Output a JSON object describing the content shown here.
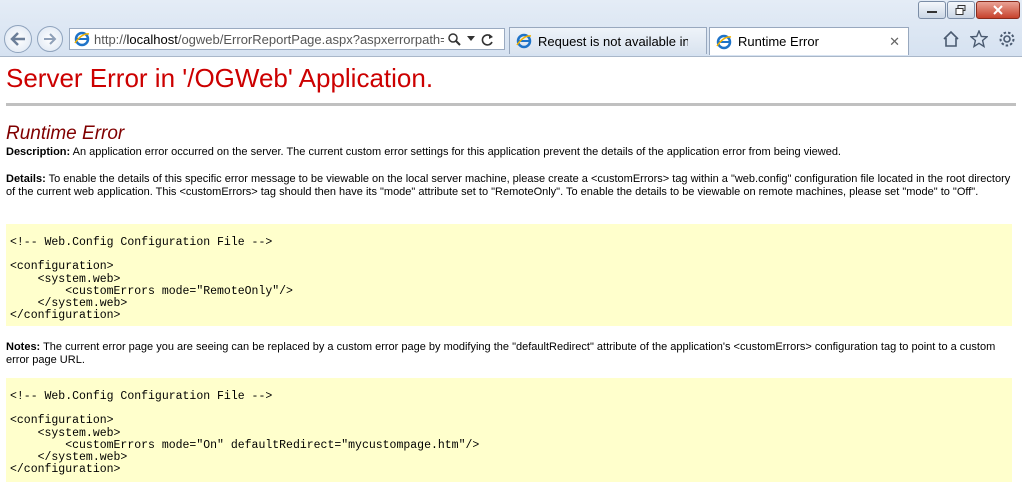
{
  "browser": {
    "url_prefix": "http://",
    "url_host": "localhost",
    "url_path": "/ogweb/ErrorReportPage.aspx?aspxerrorpath=",
    "tabs": [
      {
        "title": "Request is not available in th..."
      },
      {
        "title": "Runtime Error"
      }
    ]
  },
  "page": {
    "heading": "Server Error in '/OGWeb' Application.",
    "subheading": "Runtime Error",
    "description_label": "Description:",
    "description_text": " An application error occurred on the server. The current custom error settings for this application prevent the details of the application error from being viewed.",
    "details_label": "Details:",
    "details_text": " To enable the details of this specific error message to be viewable on the local server machine, please create a <customErrors> tag within a \"web.config\" configuration file located in the root directory of the current web application. This <customErrors> tag should then have its \"mode\" attribute set to \"RemoteOnly\". To enable the details to be viewable on remote machines, please set \"mode\" to \"Off\".",
    "code1": "<!-- Web.Config Configuration File -->\n\n<configuration>\n    <system.web>\n        <customErrors mode=\"RemoteOnly\"/>\n    </system.web>\n</configuration>",
    "notes_label": "Notes:",
    "notes_text": " The current error page you are seeing can be replaced by a custom error page by modifying the \"defaultRedirect\" attribute of the application's <customErrors> configuration tag to point to a custom error page URL.",
    "code2": "<!-- Web.Config Configuration File -->\n\n<configuration>\n    <system.web>\n        <customErrors mode=\"On\" defaultRedirect=\"mycustompage.htm\"/>\n    </system.web>\n</configuration>"
  }
}
